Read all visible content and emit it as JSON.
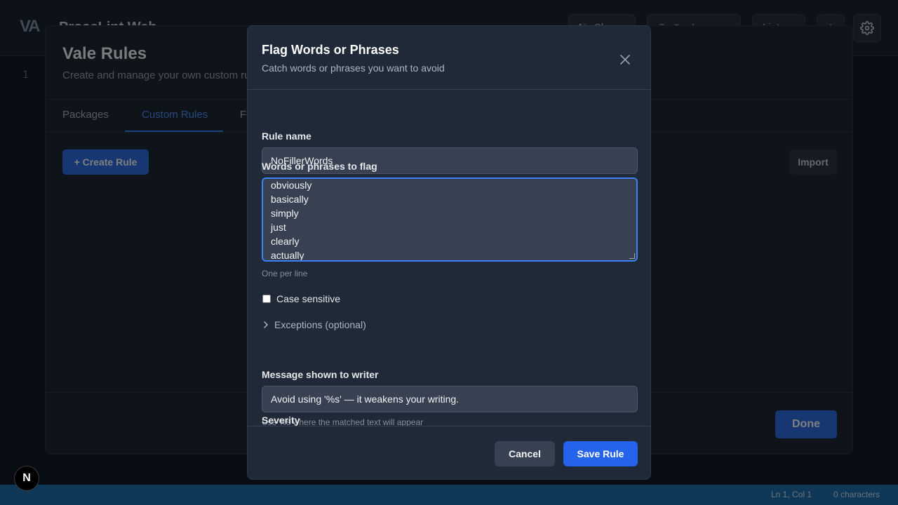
{
  "app": {
    "logo_text": "VA",
    "title": "ProseLint Web",
    "header_buttons": [
      "Share",
      "Packages",
      "Lint"
    ],
    "line_number": "1"
  },
  "status_bar": {
    "cursor": "Ln 1, Col 1",
    "char_count": "0 characters"
  },
  "next_badge": "N",
  "vale": {
    "title": "Vale Rules",
    "subtitle": "Create and manage your own custom rules",
    "tabs": [
      {
        "label": "Packages",
        "active": false
      },
      {
        "label": "Custom Rules",
        "active": true
      },
      {
        "label": "Fo",
        "active": false
      }
    ],
    "create_button": "+ Create Rule",
    "import_button": "Import",
    "done_button": "Done"
  },
  "modal": {
    "title": "Flag Words or Phrases",
    "subtitle": "Catch words or phrases you want to avoid",
    "rule_name": {
      "label": "Rule name",
      "value": "NoFillerWords"
    },
    "words": {
      "label": "Words or phrases to flag",
      "lines": [
        "obviously",
        "basically",
        "simply",
        "just",
        "clearly",
        "actually"
      ],
      "hint": "One per line"
    },
    "case_sensitive": {
      "label": "Case sensitive",
      "checked": false
    },
    "exceptions": {
      "label": "Exceptions (optional)"
    },
    "message": {
      "label": "Message shown to writer",
      "value": "Avoid using '%s' — it weakens your writing.",
      "hint": "Use %s where the matched text will appear"
    },
    "severity": {
      "label": "Severity"
    },
    "cancel_button": "Cancel",
    "save_button": "Save Rule"
  },
  "colors": {
    "accent": "#2563eb",
    "focus": "#3b82f6",
    "status_bar": "#1f6fb0"
  }
}
